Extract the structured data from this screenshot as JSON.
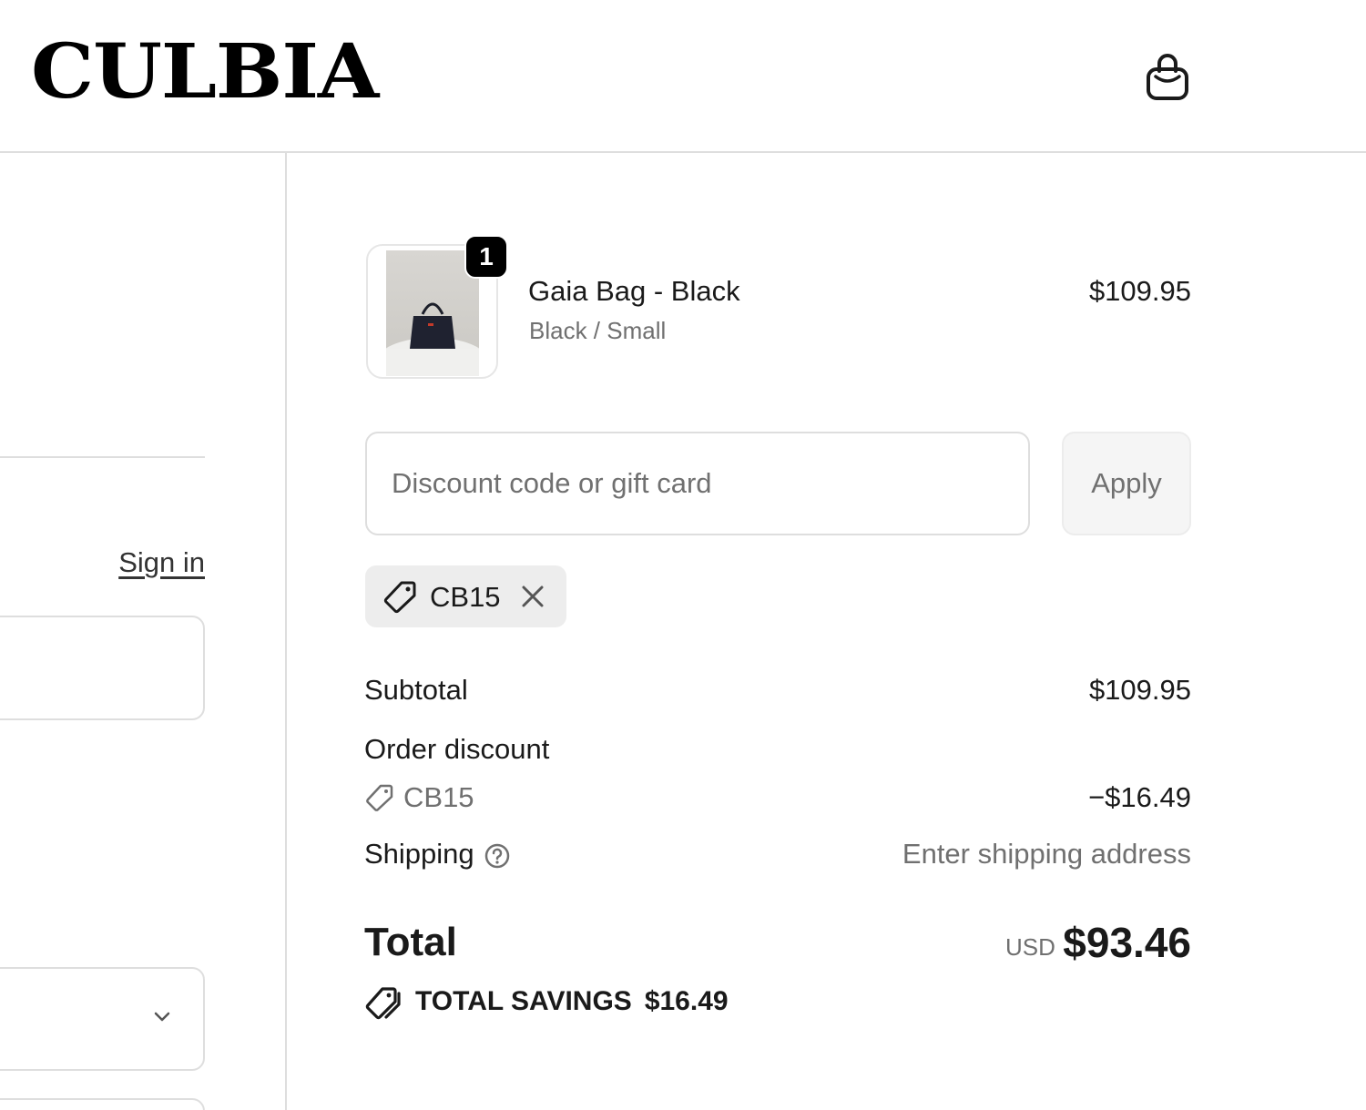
{
  "header": {
    "brand": "CULBIA",
    "cart_icon": "shopping-bag-icon"
  },
  "left": {
    "signin_label": "Sign in"
  },
  "cart": {
    "items": [
      {
        "name": "Gaia Bag - Black",
        "variant": "Black / Small",
        "price": "$109.95",
        "quantity": "1"
      }
    ]
  },
  "discount": {
    "placeholder": "Discount code or gift card",
    "apply_label": "Apply",
    "applied_code": "CB15"
  },
  "summary": {
    "subtotal_label": "Subtotal",
    "subtotal_value": "$109.95",
    "order_discount_label": "Order discount",
    "discount_code": "CB15",
    "discount_value": "−$16.49",
    "shipping_label": "Shipping",
    "shipping_value": "Enter shipping address",
    "total_label": "Total",
    "currency": "USD",
    "total_value": "$93.46",
    "savings_label": "TOTAL SAVINGS",
    "savings_value": "$16.49"
  },
  "colors": {
    "text": "#1a1a1a",
    "muted": "#707070",
    "border": "#dedede",
    "chip_bg": "#ededed"
  }
}
